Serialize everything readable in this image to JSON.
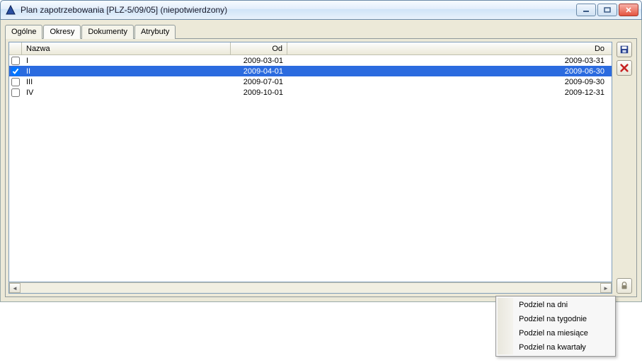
{
  "window": {
    "title": "Plan zapotrzebowania [PLZ-5/09/05]  (niepotwierdzony)"
  },
  "tabs": [
    {
      "label": "Ogólne"
    },
    {
      "label": "Okresy"
    },
    {
      "label": "Dokumenty"
    },
    {
      "label": "Atrybuty"
    }
  ],
  "columns": {
    "name": "Nazwa",
    "from": "Od",
    "to": "Do"
  },
  "rows": [
    {
      "checked": false,
      "name": "I",
      "from": "2009-03-01",
      "to": "2009-03-31",
      "selected": false
    },
    {
      "checked": true,
      "name": "II",
      "from": "2009-04-01",
      "to": "2009-06-30",
      "selected": true
    },
    {
      "checked": false,
      "name": "III",
      "from": "2009-07-01",
      "to": "2009-09-30",
      "selected": false
    },
    {
      "checked": false,
      "name": "IV",
      "from": "2009-10-01",
      "to": "2009-12-31",
      "selected": false
    }
  ],
  "menu": {
    "items": [
      "Podziel na dni",
      "Podziel na tygodnie",
      "Podziel na miesiące",
      "Podziel na kwartały"
    ]
  }
}
